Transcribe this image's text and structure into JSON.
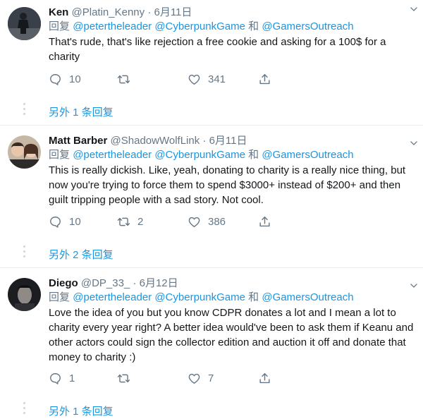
{
  "tweets": [
    {
      "name": "Ken",
      "handle": "@Platin_Kenny",
      "dot": "·",
      "date": "6月11日",
      "reply_prefix": "回复",
      "mention1": "@petertheleader",
      "mention2": "@CyberpunkGame",
      "conj": "和",
      "mention3": "@GamersOutreach",
      "text": "That's rude, that's like rejection a free cookie and asking for a 100$ for a charity",
      "reply_count": "10",
      "retweet_count": "",
      "like_count": "341",
      "more_replies": "另外 1 条回复"
    },
    {
      "name": "Matt Barber",
      "handle": "@ShadowWolfLink",
      "dot": "·",
      "date": "6月11日",
      "reply_prefix": "回复",
      "mention1": "@petertheleader",
      "mention2": "@CyberpunkGame",
      "conj": "和",
      "mention3": "@GamersOutreach",
      "text": "This is really dickish. Like, yeah, donating to charity is a really nice thing, but now you're trying to force them to spend $3000+ instead of $200+ and then guilt tripping people with a sad story. Not cool.",
      "reply_count": "10",
      "retweet_count": "2",
      "like_count": "386",
      "more_replies": "另外 2 条回复"
    },
    {
      "name": "Diego",
      "handle": "@DP_33_",
      "dot": "·",
      "date": "6月12日",
      "reply_prefix": "回复",
      "mention1": "@petertheleader",
      "mention2": "@CyberpunkGame",
      "conj": "和",
      "mention3": "@GamersOutreach",
      "text": "Love the idea of you but you know CDPR donates a lot and I mean a lot to charity every year right? A better idea would've been to ask them if Keanu and other actors could sign the collector edition and auction it off and donate that money to charity :)",
      "reply_count": "1",
      "retweet_count": "",
      "like_count": "7",
      "more_replies": "另外 1 条回复"
    }
  ],
  "icons": {
    "reply": "reply-icon",
    "retweet": "retweet-icon",
    "like": "heart-icon",
    "share": "share-icon",
    "caret": "chevron-down-icon"
  },
  "colors": {
    "link": "#1b95e0",
    "muted": "#657786",
    "divider": "#e6ecf0"
  }
}
